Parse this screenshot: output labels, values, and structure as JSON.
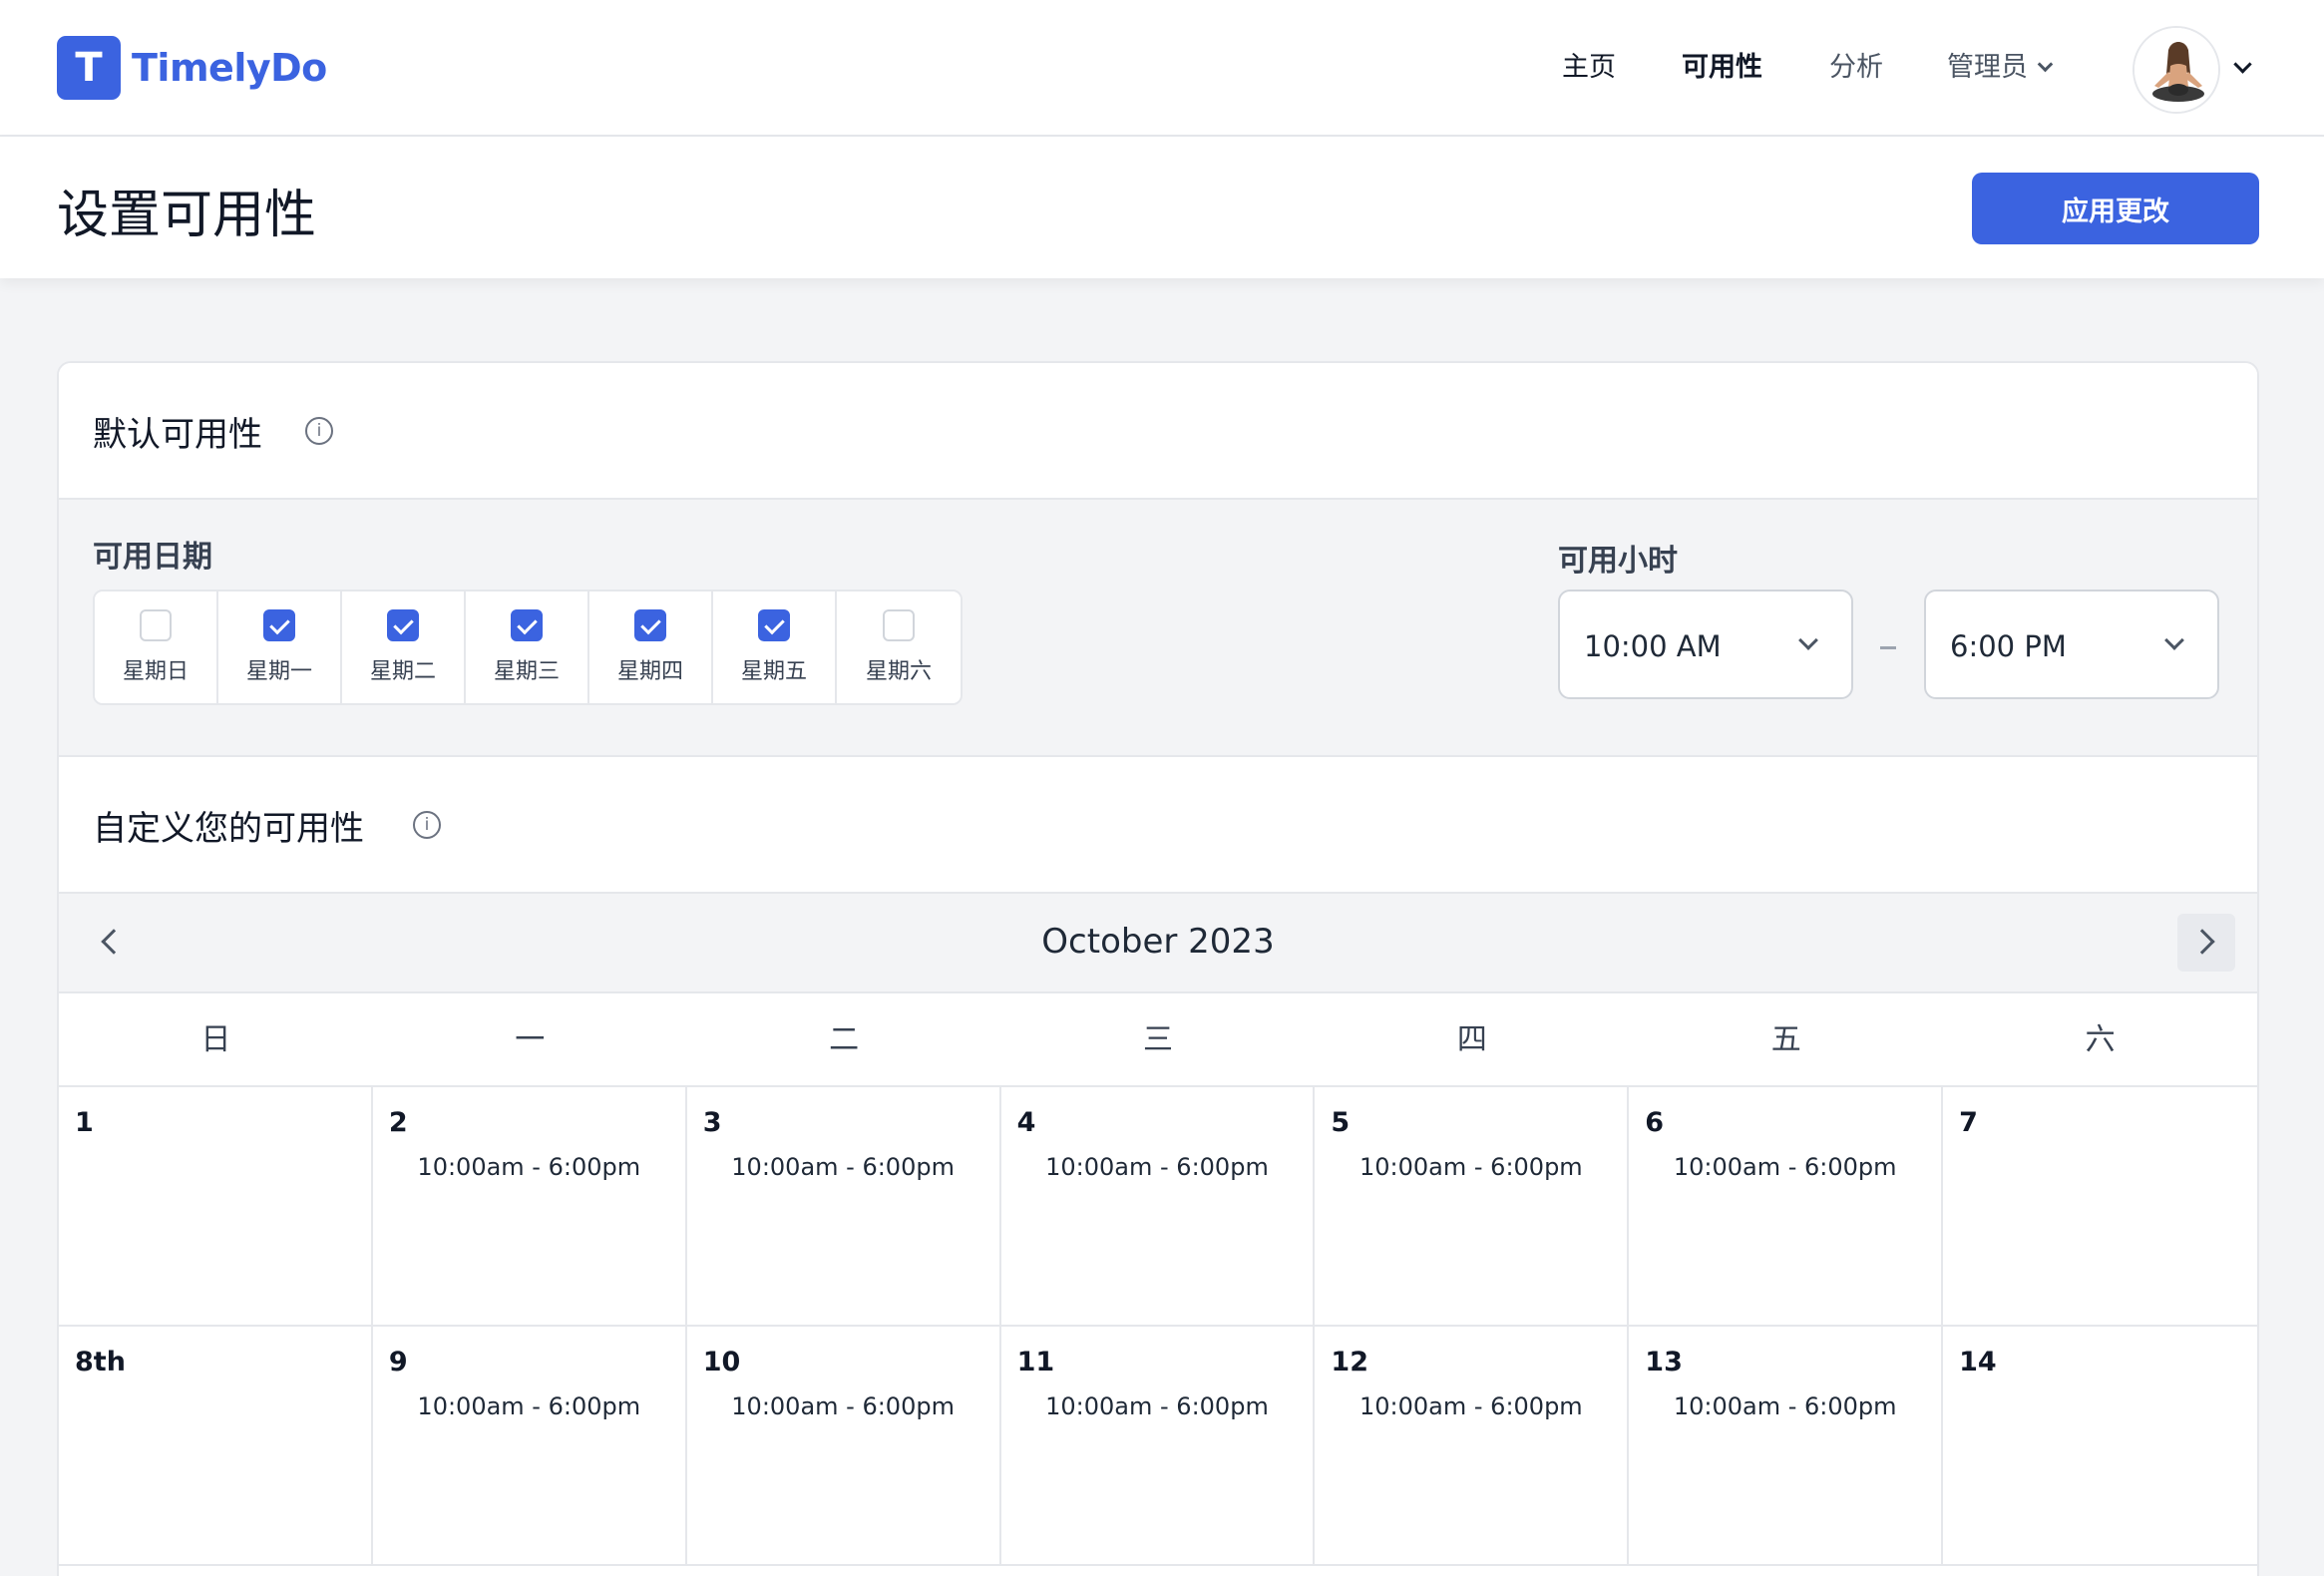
{
  "app": {
    "logo_letter": "T",
    "name": "TimelyDo",
    "brand_color": "#3b63e0"
  },
  "nav": {
    "home": "主页",
    "availability": "可用性",
    "analytics": "分析",
    "admin": "管理员"
  },
  "header": {
    "title": "设置可用性",
    "apply_label": "应用更改"
  },
  "default_section": {
    "title": "默认可用性",
    "days_label": "可用日期",
    "hours_label": "可用小时",
    "days": [
      {
        "label": "星期日",
        "checked": false
      },
      {
        "label": "星期一",
        "checked": true
      },
      {
        "label": "星期二",
        "checked": true
      },
      {
        "label": "星期三",
        "checked": true
      },
      {
        "label": "星期四",
        "checked": true
      },
      {
        "label": "星期五",
        "checked": true
      },
      {
        "label": "星期六",
        "checked": false
      }
    ],
    "start_time": "10:00 AM",
    "end_time": "6:00 PM"
  },
  "custom_section": {
    "title": "自定义您的可用性"
  },
  "calendar": {
    "month_title": "October 2023",
    "weekdays": [
      "日",
      "一",
      "二",
      "三",
      "四",
      "五",
      "六"
    ],
    "cells": [
      {
        "day": "1",
        "hours": ""
      },
      {
        "day": "2",
        "hours": "10:00am - 6:00pm"
      },
      {
        "day": "3",
        "hours": "10:00am - 6:00pm"
      },
      {
        "day": "4",
        "hours": "10:00am - 6:00pm"
      },
      {
        "day": "5",
        "hours": "10:00am - 6:00pm"
      },
      {
        "day": "6",
        "hours": "10:00am - 6:00pm"
      },
      {
        "day": "7",
        "hours": ""
      },
      {
        "day": "8th",
        "hours": ""
      },
      {
        "day": "9",
        "hours": "10:00am - 6:00pm"
      },
      {
        "day": "10",
        "hours": "10:00am - 6:00pm"
      },
      {
        "day": "11",
        "hours": "10:00am - 6:00pm"
      },
      {
        "day": "12",
        "hours": "10:00am - 6:00pm"
      },
      {
        "day": "13",
        "hours": "10:00am - 6:00pm"
      },
      {
        "day": "14",
        "hours": ""
      }
    ]
  }
}
